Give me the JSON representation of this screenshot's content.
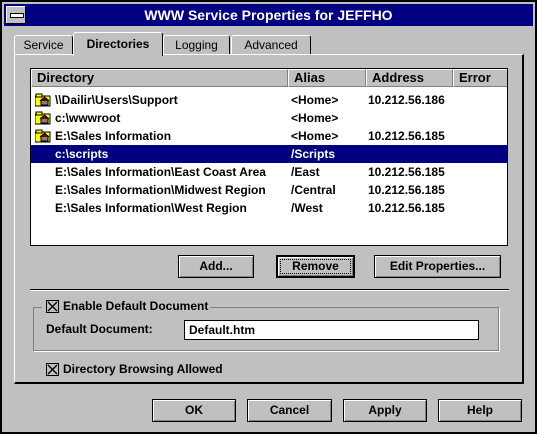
{
  "window": {
    "title": "WWW Service Properties for JEFFHO"
  },
  "tabs": [
    {
      "label": "Service"
    },
    {
      "label": "Directories"
    },
    {
      "label": "Logging"
    },
    {
      "label": "Advanced"
    }
  ],
  "directory_list": {
    "columns": [
      "Directory",
      "Alias",
      "Address",
      "Error"
    ],
    "rows": [
      {
        "directory": "\\\\Dailir\\Users\\Support",
        "alias": "<Home>",
        "address": "10.212.56.186",
        "error": "",
        "icon": "home-folder-icon"
      },
      {
        "directory": "c:\\wwwroot",
        "alias": "<Home>",
        "address": "",
        "error": "",
        "icon": "home-folder-icon"
      },
      {
        "directory": "E:\\Sales Information",
        "alias": "<Home>",
        "address": "10.212.56.185",
        "error": "",
        "icon": "home-folder-icon"
      },
      {
        "directory": "c:\\scripts",
        "alias": "/Scripts",
        "address": "",
        "error": ""
      },
      {
        "directory": "E:\\Sales Information\\East Coast Area",
        "alias": "/East",
        "address": "10.212.56.185",
        "error": ""
      },
      {
        "directory": "E:\\Sales Information\\Midwest Region",
        "alias": "/Central",
        "address": "10.212.56.185",
        "error": ""
      },
      {
        "directory": "E:\\Sales Information\\West Region",
        "alias": "/West",
        "address": "10.212.56.185",
        "error": ""
      }
    ],
    "selected_row": 3
  },
  "list_buttons": {
    "add": "Add...",
    "remove": "Remove",
    "edit_properties": "Edit Properties..."
  },
  "default_document": {
    "enable_label": "Enable Default Document",
    "enabled": true,
    "field_label": "Default Document:",
    "value": "Default.htm"
  },
  "directory_browsing": {
    "label": "Directory Browsing Allowed",
    "enabled": true
  },
  "footer_buttons": {
    "ok": "OK",
    "cancel": "Cancel",
    "apply": "Apply",
    "help": "Help"
  },
  "colors": {
    "selection": "#000080",
    "face": "#c0c0c0"
  }
}
